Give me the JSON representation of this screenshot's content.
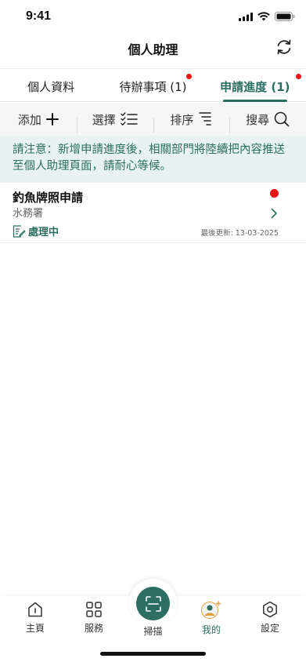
{
  "status_bar": {
    "time": "9:41"
  },
  "header": {
    "title": "個人助理"
  },
  "tabs": [
    {
      "label": "個人資料",
      "has_dot": false,
      "active": false
    },
    {
      "label": "待辦事項 (1)",
      "has_dot": true,
      "active": false
    },
    {
      "label": "申請進度 (1)",
      "has_dot": true,
      "active": true
    }
  ],
  "toolbar": {
    "add_label": "添加",
    "select_label": "選擇",
    "sort_label": "排序",
    "search_label": "搜尋"
  },
  "notice": {
    "text": "請注意：新增申請進度後，相關部門將陸續把內容推送至個人助理頁面，請耐心等候。"
  },
  "applications": [
    {
      "title": "釣魚牌照申請",
      "department": "水務署",
      "status": "處理中",
      "last_updated": "最後更新: 13-03-2025"
    }
  ],
  "bottom_nav": {
    "home": "主頁",
    "services": "服務",
    "scan": "掃描",
    "mine": "我的",
    "settings": "設定"
  },
  "colors": {
    "accent": "#2c6e60",
    "badge": "#e11111",
    "notice_bg": "#e8f3f1"
  }
}
